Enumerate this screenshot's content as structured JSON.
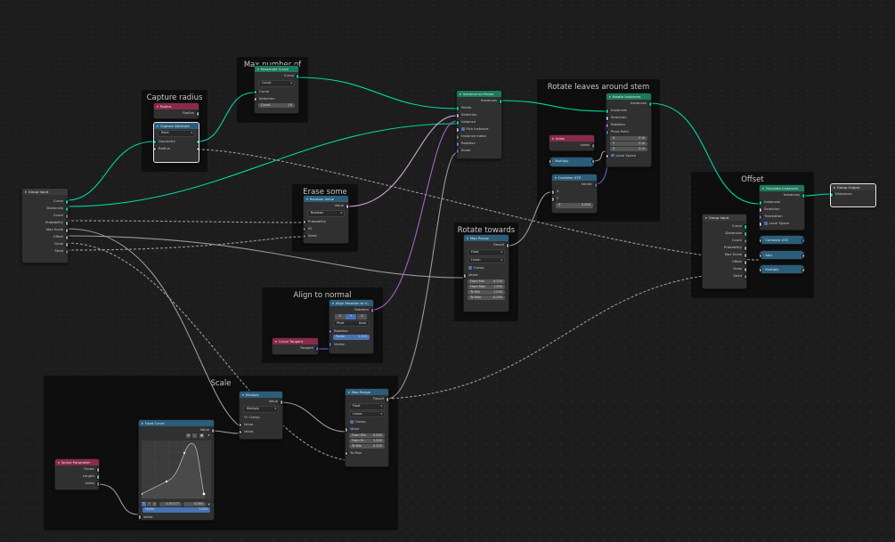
{
  "frames": {
    "max_branches": "Max number of branches",
    "capture_radius": "Capture radius",
    "erase_leaves": "Erase some leaves",
    "rotate_leaves": "Rotate leaves around stem",
    "rotate_up": "Rotate towards up",
    "align_normal": "Align to normal",
    "scale": "Scale",
    "offset": "Offset"
  },
  "nodes": {
    "group_input_main": {
      "title": "Group Input",
      "outputs": [
        "Curve",
        "Distances",
        "Count",
        "Probability",
        "Max Scale",
        "Offset",
        "Grow",
        "Seed"
      ]
    },
    "radius": {
      "title": "Radius",
      "outputs": [
        "Radius"
      ]
    },
    "capture_attribute": {
      "title": "Capture Attribute",
      "domain": "Point",
      "inputs": [
        "Geometry",
        "Radius"
      ]
    },
    "resample_curve": {
      "title": "Resample Curve",
      "output": "Curve",
      "mode": "Count",
      "inputs": [
        "Curve",
        "Selection"
      ],
      "count_label": "Count",
      "count_value": "10"
    },
    "instance_on_points": {
      "title": "Instance on Points",
      "output": "Instances",
      "inputs": [
        "Points",
        "Selection",
        "Instance"
      ],
      "pick_instance": "Pick Instance",
      "inputs2": [
        "Instance Index",
        "Rotation",
        "Scale"
      ]
    },
    "rotate_instances": {
      "title": "Rotate Instances",
      "output": "Instances",
      "inputs": [
        "Instances",
        "Selection",
        "Rotation",
        "Pivot Point"
      ],
      "pivot": [
        {
          "axis": "X",
          "value": "0 m"
        },
        {
          "axis": "Y",
          "value": "0 m"
        },
        {
          "axis": "Z",
          "value": "0 m"
        }
      ],
      "local_space": "Local Space"
    },
    "index": {
      "title": "Index",
      "output": "Index"
    },
    "multiply_small": {
      "title": "Multiply"
    },
    "combine_xyz_main": {
      "title": "Combine XYZ",
      "output": "Vector",
      "inputs": [
        "X",
        "Y"
      ],
      "z_label": "Z",
      "z_value": "0.000"
    },
    "random_value": {
      "title": "Random Value",
      "output": "Value",
      "type": "Boolean",
      "inputs": [
        "Probability",
        "ID",
        "Seed"
      ]
    },
    "map_range_up": {
      "title": "Map Range",
      "output": "Result",
      "type": "Float",
      "interp": "Linear",
      "clamp": "Clamp",
      "input": "Value",
      "fields": [
        {
          "label": "From Min",
          "value": "0.200"
        },
        {
          "label": "From Max",
          "value": "1.000"
        },
        {
          "label": "To Min",
          "value": "1.200"
        },
        {
          "label": "To Max",
          "value": "-0.290"
        }
      ]
    },
    "align_rotation": {
      "title": "Align Rotation to V...",
      "output": "Rotation",
      "axes": [
        "X",
        "Y",
        "Z"
      ],
      "pivot_label": "Pivot",
      "pivot_value": "Auto",
      "inputs": [
        "Rotation"
      ],
      "factor_label": "Factor",
      "factor_value": "1.000",
      "input_vec": "Vector"
    },
    "curve_tangent": {
      "title": "Curve Tangent",
      "output": "Tangent"
    },
    "multiply_scale": {
      "title": "Multiply",
      "output": "Value",
      "op": "Multiply",
      "clamp": "Clamp",
      "inputs": [
        "Value",
        "Value"
      ]
    },
    "map_range_scale": {
      "title": "Map Range",
      "output": "Result",
      "type": "Float",
      "interp": "Linear",
      "clamp": "Clamp",
      "input": "Value",
      "fields": [
        {
          "label": "From Min",
          "value": "0.000"
        },
        {
          "label": "From M...",
          "value": "1.000"
        },
        {
          "label": "To Min",
          "value": "0.200"
        }
      ],
      "input2": "To Max"
    },
    "float_curve": {
      "title": "Float Curve",
      "output": "Value",
      "x_value": "0.91177",
      "y_value": "0.084",
      "factor_label": "Factor",
      "factor_value": "1.000",
      "input": "Value"
    },
    "spline_parameter": {
      "title": "Spline Parameter",
      "outputs": [
        "Factor",
        "Length",
        "Index"
      ]
    },
    "group_input_offset": {
      "title": "Group Input",
      "outputs": [
        "Curve",
        "Distances",
        "Count",
        "Probability",
        "Max Scale",
        "Offset",
        "Grow",
        "Seed"
      ]
    },
    "translate_instances": {
      "title": "Translate Instances",
      "output": "Instances",
      "inputs": [
        "Instances",
        "Selection",
        "Translation"
      ],
      "local_space": "Local Space"
    },
    "combine_xyz_offset": {
      "title": "Combine XYZ"
    },
    "add": {
      "title": "Add"
    },
    "multiply_offset": {
      "title": "Multiply"
    },
    "group_output": {
      "title": "Group Output",
      "input": "Distances"
    }
  }
}
